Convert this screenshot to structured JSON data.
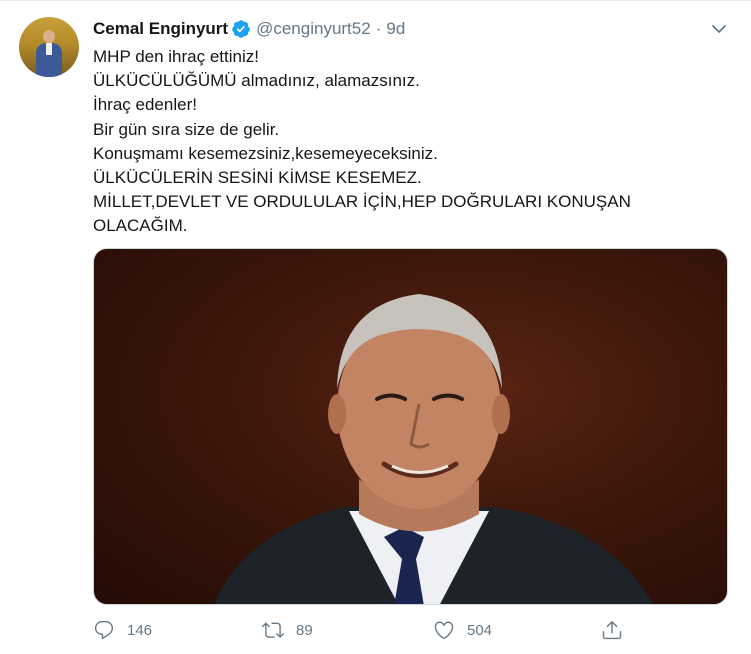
{
  "tweet": {
    "author_name": "Cemal Enginyurt",
    "handle": "@cenginyurt52",
    "separator": "·",
    "time": "9d",
    "text": "MHP den ihraç ettiniz!\nÜLKÜCÜLÜĞÜMÜ almadınız, alamazsınız.\nİhraç edenler!\nBir gün sıra size de gelir.\nKonuşmamı kesemezsiniz,kesemeyeceksiniz.\nÜLKÜCÜLERİN SESİNİ KİMSE KESEMEZ.\nMİLLET,DEVLET VE ORDULULAR İÇİN,HEP DOĞRULARI KONUŞAN\nOLACAĞIM."
  },
  "actions": {
    "reply_count": "146",
    "retweet_count": "89",
    "like_count": "504"
  },
  "icons": {
    "verified": "verified-badge-icon",
    "caret": "chevron-down-icon",
    "reply": "reply-icon",
    "retweet": "retweet-icon",
    "like": "heart-icon",
    "share": "share-icon"
  },
  "colors": {
    "accent": "#1da1f2",
    "muted": "#657786",
    "text": "#14171a"
  }
}
